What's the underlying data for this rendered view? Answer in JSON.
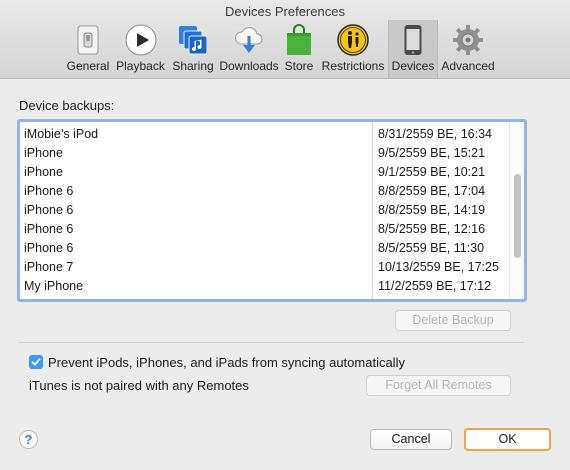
{
  "window": {
    "title": "Devices Preferences"
  },
  "toolbar": {
    "tabs": [
      {
        "label": "General",
        "icon": "general-icon"
      },
      {
        "label": "Playback",
        "icon": "play-icon"
      },
      {
        "label": "Sharing",
        "icon": "sharing-icon"
      },
      {
        "label": "Downloads",
        "icon": "downloads-icon"
      },
      {
        "label": "Store",
        "icon": "store-bag-icon"
      },
      {
        "label": "Restrictions",
        "icon": "restrictions-icon"
      },
      {
        "label": "Devices",
        "icon": "iphone-icon",
        "selected": true
      },
      {
        "label": "Advanced",
        "icon": "gear-icon"
      }
    ]
  },
  "backups": {
    "label": "Device backups:",
    "rows": [
      {
        "name": "iMobie’s iPod",
        "date": "8/31/2559 BE, 16:34"
      },
      {
        "name": "iPhone",
        "date": "9/5/2559 BE, 15:21"
      },
      {
        "name": "iPhone",
        "date": "9/1/2559 BE, 10:21"
      },
      {
        "name": "iPhone 6",
        "date": "8/8/2559 BE, 17:04"
      },
      {
        "name": "iPhone 6",
        "date": "8/8/2559 BE, 14:19"
      },
      {
        "name": "iPhone 6",
        "date": "8/5/2559 BE, 12:16"
      },
      {
        "name": "iPhone 6",
        "date": "8/5/2559 BE, 11:30"
      },
      {
        "name": "iPhone 7",
        "date": "10/13/2559 BE, 17:25"
      },
      {
        "name": "My iPhone",
        "date": "11/2/2559 BE, 17:12"
      }
    ],
    "delete_button": "Delete Backup"
  },
  "sync": {
    "checkbox_label": "Prevent iPods, iPhones, and iPads from syncing automatically",
    "checked": true
  },
  "remotes": {
    "status": "iTunes is not paired with any Remotes",
    "forget_button": "Forget All Remotes"
  },
  "footer": {
    "help": "?",
    "cancel": "Cancel",
    "ok": "OK"
  },
  "colors": {
    "accent": "#3b99fc",
    "focus_ring": "#90b5ea",
    "default_button_ring": "#f5a04a"
  }
}
